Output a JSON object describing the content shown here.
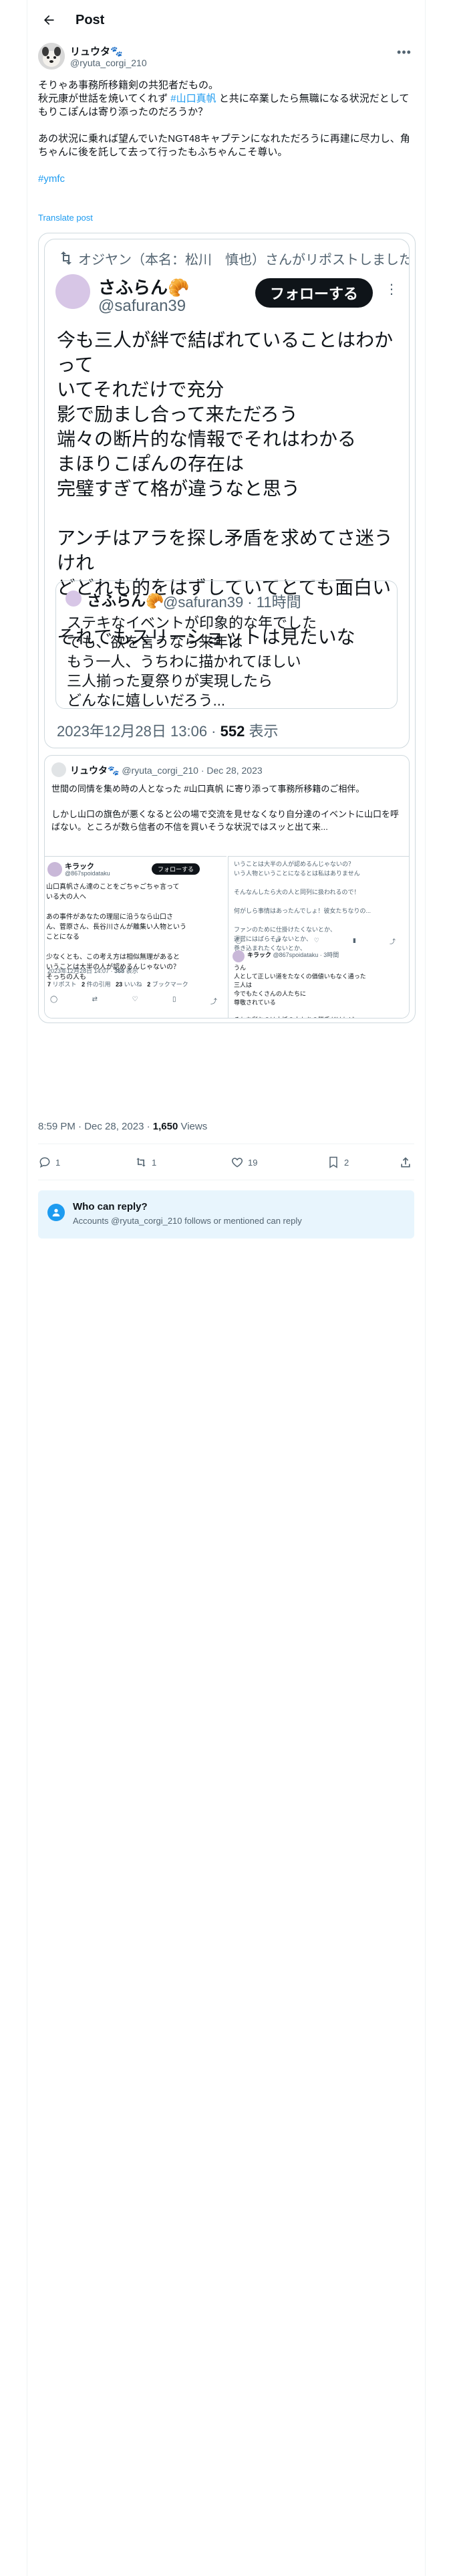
{
  "header": {
    "title": "Post"
  },
  "author": {
    "name": "リュウタ🐾",
    "handle": "@ryuta_corgi_210"
  },
  "post": {
    "paragraph1_line1": "そりゃあ事務所移籍剣の共犯者だもの。",
    "paragraph1_line2_pre": "秋元康が世話を焼いてくれず ",
    "paragraph1_hashtag": "#山口真帆",
    "paragraph1_line2_post": " と共に卒業したら無職になる状況だとしてもりこぽんは寄り添ったのだろうか？",
    "paragraph2": "あの状況に乗れば望んでいたNGT48キャプテンになれただろうに再建に尽力し、角ちゃんに後を託して去って行ったもふちゃんこそ尊い。",
    "hashtag": "#ymfc",
    "translate": "Translate post"
  },
  "embedded": {
    "repost_line": "オジヤン（本名：松川　慎也）さんがリポストしました",
    "card1": {
      "name": "さふらん🥐",
      "handle": "@safuran39",
      "follow": "フォローする",
      "text": "今も三人が絆で結ばれていることはわかって\nいてそれだけで充分\n影で励まし合って来ただろう\n端々の断片的な情報でそれはわかる\nまほりこぽんの存在は\n完璧すぎて格が違うなと思う\n\nアンチはアラを探し矛盾を求めてさ迷うけれ\nどどれも的をはずしていてとても面白い\n\nそれでもスリーショットは見たいな",
      "quote": {
        "name": "さふらん🥐",
        "handle": "@safuran39 · 11時間",
        "text": "ステキなイベントが印象的な年でした\nでも、欲を言うなら来年は\nもう一人、うちわに描かれてほしい\n三人揃った夏祭りが実現したら\nどんなに嬉しいだろう..."
      },
      "date": "2023年12月28日 13:06 · ",
      "views_num": "552",
      "views_label": " 表示"
    },
    "card2": {
      "name": "リュウタ🐾",
      "handle_date": "@ryuta_corgi_210 · Dec 28, 2023",
      "text": "世間の同情を集め時の人となった #山口真帆 に寄り添って事務所移籍のご相伴。\n\nしかし山口の旗色が悪くなると公の場で交流を見せなくなり自分達のイベントに山口を呼ばない。ところが数ら信者の不信を買いそうな状況ではスッと出て来...",
      "sub_left": {
        "name": "キラック",
        "handle": "@867spoidataku",
        "follow": "フォローする",
        "text": "山口真帆さん達のことをごちゃごちゃ言って\nいる大の人へ\n\nあの事件があなたの理屈に沿うなら山口さ\nん、菅原さん、長谷川さんが離集い人物という\nことになる\n\n少なくとも、この考え方は相似無理があると\nいうことは大半の人が認めるんじゃないの？\nそっちの人も",
        "date": "2023年12月28日 14:07 · ",
        "views_num": "368",
        "views_label": " 表示",
        "stats": [
          {
            "label": "リポスト",
            "num": "7"
          },
          {
            "label": "件の引用",
            "num": "2"
          },
          {
            "label": "いいね",
            "num": "23"
          },
          {
            "label": "ブックマーク",
            "num": "2"
          }
        ]
      },
      "sub_right": {
        "text": "いうことは大半の人が認めるんじゃないの？\nいう人物ということになるとは私はありません\n\nそんなんしたら大の人と同列に扱われるので！\n\n何がしら事情はあったんでしょ！彼女たちなりの...\n\nファンのために仕掛けたくないとか、\n運営にはばらそうないとか、\n巻き込まれたくないとか、",
        "reply_name": "キラック",
        "reply_handle": " @867spoidataku · 3時間",
        "reply_text": "うん\n人として正しい道をたなくの価値いもなく通った\n三人は\n今でもたくさんの人たちに\n尊敬されている\n\nそれを彩むのは大抵の人たちの勝手だけれど..."
      }
    }
  },
  "meta": {
    "time": "8:59 PM · Dec 28, 2023 · ",
    "views_num": "1,650",
    "views_label": " Views"
  },
  "actions": {
    "replies": "1",
    "reposts": "1",
    "likes": "19",
    "bookmarks": "2"
  },
  "reply_notice": {
    "title": "Who can reply?",
    "subtitle": "Accounts @ryuta_corgi_210 follows or mentioned can reply"
  },
  "colors": {
    "accent": "#1d9bf0",
    "text": "#0f1419",
    "muted": "#536471"
  }
}
